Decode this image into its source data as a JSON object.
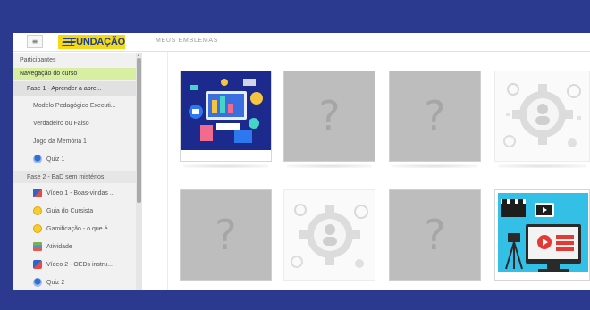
{
  "logo": {
    "text": "FUNDAÇÃO"
  },
  "header": {
    "menu_icon": "≡",
    "title": "MEUS EMBLEMAS"
  },
  "sidebar": {
    "items": [
      {
        "label": "Participantes"
      },
      {
        "label": "Navegação do curso"
      },
      {
        "label": "Fase 1 - Aprender a apre..."
      },
      {
        "label": "Modelo Pedagógico Executi..."
      },
      {
        "label": "Verdadeiro ou Falso"
      },
      {
        "label": "Jogo da Memória 1"
      },
      {
        "label": "Quiz 1",
        "icon": "quiz-icon"
      },
      {
        "label": "Fase 2 - EaD sem mistérios"
      },
      {
        "label": "Vídeo 1 - Boas-vindas ...",
        "icon": "video-icon"
      },
      {
        "label": "Guia do Cursista",
        "icon": "guide-icon"
      },
      {
        "label": "Gamificação - o que é ...",
        "icon": "guide-icon"
      },
      {
        "label": "Atividade",
        "icon": "activity-icon"
      },
      {
        "label": "Vídeo 2 - OEDs instru...",
        "icon": "video-icon"
      },
      {
        "label": "Quiz 2",
        "icon": "quiz-icon"
      }
    ]
  },
  "badges": [
    {
      "state": "earned",
      "icon": "digital-technology-illustration"
    },
    {
      "state": "unknown",
      "symbol": "?"
    },
    {
      "state": "unknown",
      "symbol": "?"
    },
    {
      "state": "locked",
      "icon": "gear-person-icon"
    },
    {
      "state": "unknown",
      "symbol": "?"
    },
    {
      "state": "locked",
      "icon": "gear-person-icon"
    },
    {
      "state": "unknown",
      "symbol": "?"
    },
    {
      "state": "earned",
      "icon": "video-production-illustration"
    }
  ],
  "colors": {
    "frame_border": "#2b3a8f",
    "logo_bg": "#f6d915",
    "logo_text": "#1f3f8f",
    "active_nav": "#d8eea0"
  }
}
